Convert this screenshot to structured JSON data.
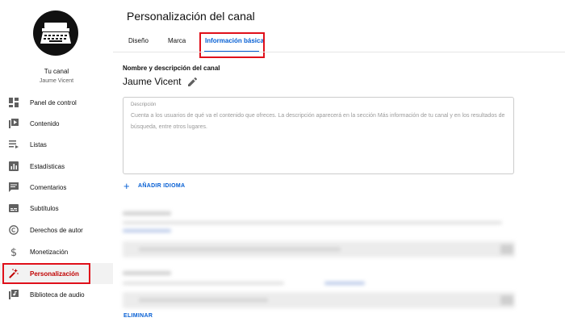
{
  "sidebar": {
    "channel_label": "Tu canal",
    "channel_name": "Jaume Vicent",
    "items": [
      {
        "label": "Panel de control",
        "icon": "dashboard-icon"
      },
      {
        "label": "Contenido",
        "icon": "content-icon"
      },
      {
        "label": "Listas",
        "icon": "playlist-icon"
      },
      {
        "label": "Estadísticas",
        "icon": "analytics-icon"
      },
      {
        "label": "Comentarios",
        "icon": "comments-icon"
      },
      {
        "label": "Subtítulos",
        "icon": "subtitles-icon"
      },
      {
        "label": "Derechos de autor",
        "icon": "copyright-icon"
      },
      {
        "label": "Monetización",
        "icon": "dollar-icon"
      },
      {
        "label": "Personalización",
        "icon": "magic-wand-icon"
      },
      {
        "label": "Biblioteca de audio",
        "icon": "audio-library-icon"
      }
    ],
    "active_item": "Personalización"
  },
  "header": {
    "title": "Personalización del canal",
    "tabs": [
      {
        "label": "Diseño"
      },
      {
        "label": "Marca"
      },
      {
        "label": "Información básica"
      }
    ],
    "active_tab": "Información básica"
  },
  "main": {
    "section_heading": "Nombre y descripción del canal",
    "channel_name": "Jaume Vicent",
    "description": {
      "label": "Descripción",
      "placeholder": "Cuenta a los usuarios de qué va el contenido que ofreces. La descripción aparecerá en la sección Más información de tu canal y en los resultados de búsqueda, entre otros lugares."
    },
    "add_language": "AÑADIR IDIOMA",
    "remove": "ELIMINAR"
  },
  "colors": {
    "accent": "#065fd4",
    "active_nav": "#c00000",
    "highlight": "#e0101a"
  }
}
